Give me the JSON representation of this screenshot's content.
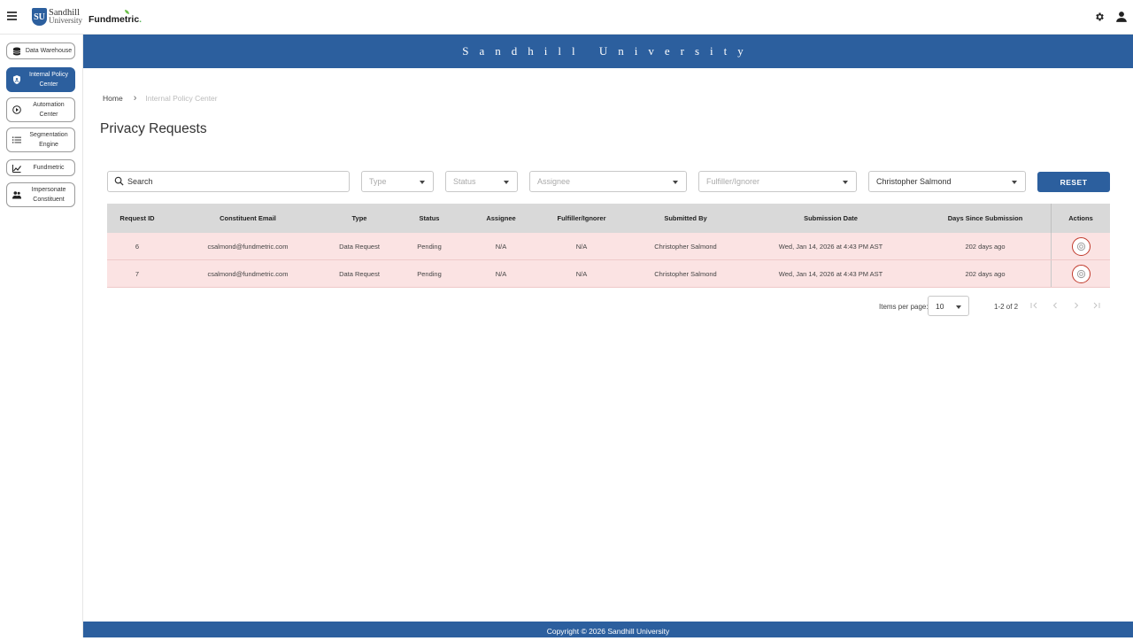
{
  "header": {
    "university_logo_line1": "Sandhill",
    "university_logo_line2": "University",
    "crest_text": "SU",
    "fundmetric_logo": "Fundmetric",
    "fundmetric_dot": "."
  },
  "sidebar": {
    "items": [
      {
        "label": "Data Warehouse",
        "icon": "database-icon",
        "active": false
      },
      {
        "label": "Internal Policy Center",
        "icon": "shield-icon",
        "active": true
      },
      {
        "label": "Automation Center",
        "icon": "play-circle-icon",
        "active": false
      },
      {
        "label": "Segmentation Engine",
        "icon": "list-icon",
        "active": false
      },
      {
        "label": "Fundmetric",
        "icon": "chart-icon",
        "active": false
      },
      {
        "label": "Impersonate Constituent",
        "icon": "people-icon",
        "active": false
      }
    ]
  },
  "banner": {
    "title": "Sandhill University"
  },
  "breadcrumb": {
    "home": "Home",
    "separator": "›",
    "current": "Internal Policy Center"
  },
  "page": {
    "title": "Privacy Requests"
  },
  "filters": {
    "search_value": "Search",
    "type_placeholder": "Type",
    "status_placeholder": "Status",
    "assignee_placeholder": "Assignee",
    "fulfiller_placeholder": "Fulfiller/Ignorer",
    "submitted_by_value": "Christopher Salmond",
    "reset_label": "RESET"
  },
  "table": {
    "headers": [
      "Request ID",
      "Constituent Email",
      "Type",
      "Status",
      "Assignee",
      "Fulfiller/Ignorer",
      "Submitted By",
      "Submission Date",
      "Days Since Submission",
      "Actions"
    ],
    "rows": [
      [
        "6",
        "csalmond@fundmetric.com",
        "Data Request",
        "Pending",
        "N/A",
        "N/A",
        "Christopher Salmond",
        "Wed, Jan 14, 2026 at 4:43 PM AST",
        "202 days ago"
      ],
      [
        "7",
        "csalmond@fundmetric.com",
        "Data Request",
        "Pending",
        "N/A",
        "N/A",
        "Christopher Salmond",
        "Wed, Jan 14, 2026 at 4:43 PM AST",
        "202 days ago"
      ]
    ]
  },
  "paginator": {
    "items_per_page_label": "Items per page:",
    "items_per_page_value": "10",
    "range_label": "1-2 of 2"
  },
  "footer": {
    "copyright": "Copyright © 2026 Sandhill University"
  },
  "colors": {
    "brand": "#2c5f9e",
    "row_highlight": "#fbe3e3",
    "action_ring": "#c0392b"
  }
}
